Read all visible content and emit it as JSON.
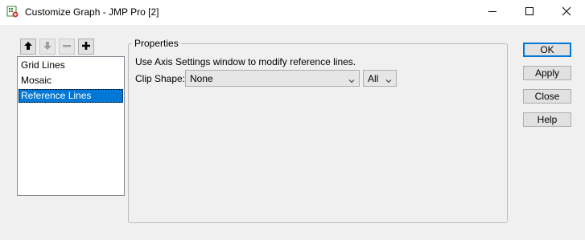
{
  "window": {
    "title": "Customize Graph - JMP Pro [2]",
    "icon": "jmp-graph-icon",
    "controls": [
      "minimize-icon",
      "maximize-icon",
      "close-icon"
    ]
  },
  "toolbar": {
    "buttons": [
      {
        "name": "move-up",
        "icon": "arrow-up-icon",
        "enabled": true
      },
      {
        "name": "move-down",
        "icon": "arrow-down-icon",
        "enabled": false
      },
      {
        "name": "remove",
        "icon": "minus-icon",
        "enabled": false
      },
      {
        "name": "add",
        "icon": "plus-icon",
        "enabled": true
      }
    ]
  },
  "list": {
    "items": [
      "Grid Lines",
      "Mosaic",
      "Reference Lines"
    ],
    "selected_index": 2
  },
  "properties": {
    "legend": "Properties",
    "description": "Use Axis Settings window to modify reference lines.",
    "clip_shape_label": "Clip Shape:",
    "clip_shape_value": "None",
    "scope_value": "All"
  },
  "buttons": {
    "ok": "OK",
    "apply": "Apply",
    "close": "Close",
    "help": "Help"
  },
  "colors": {
    "selection": "#0078d7",
    "background": "#f0f0f0"
  }
}
